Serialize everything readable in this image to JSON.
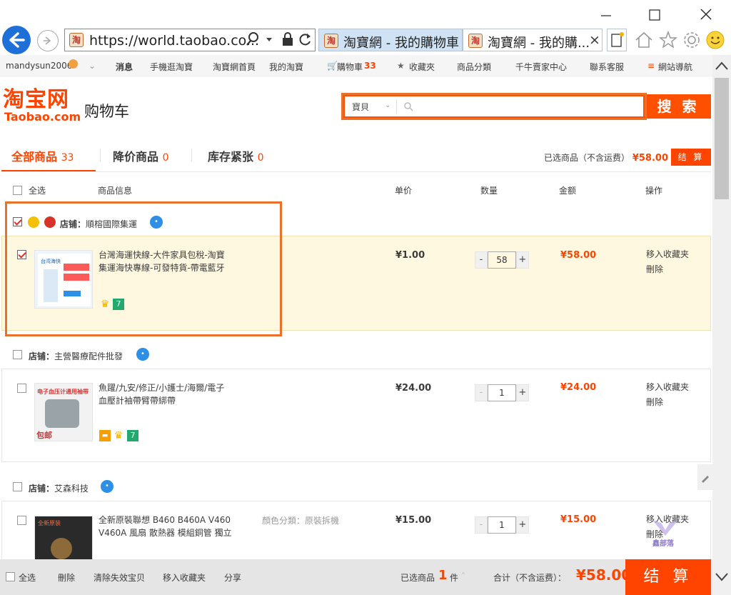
{
  "browser": {
    "url": "https://world.taobao.co...",
    "tabs": [
      {
        "title": "淘寶網 - 我的購物車"
      },
      {
        "title": "淘寶網 - 我的購..."
      }
    ],
    "tab_close": "×"
  },
  "sitenav": {
    "user": "mandysun2006",
    "messages": "消息",
    "mobile": "手機逛淘寶",
    "home": "淘寶網首頁",
    "my_taobao": "我的淘寶",
    "cart_label": "購物車",
    "cart_count": "33",
    "favorites": "收藏夾",
    "categories": "商品分類",
    "seller_center": "千牛賣家中心",
    "support": "聯系客服",
    "sitemap": "網站導航"
  },
  "header": {
    "logo_cn": "淘宝网",
    "logo_en": "Taobao.com",
    "page_title": "购物车",
    "search_category": "寶貝",
    "search_placeholder": "",
    "search_button": "搜 索"
  },
  "tabs": [
    {
      "label": "全部商品",
      "count": "33"
    },
    {
      "label": "降价商品",
      "count": "0"
    },
    {
      "label": "库存紧张",
      "count": "0"
    }
  ],
  "summary": {
    "label": "已选商品（不含运费）",
    "amount": "¥58.00",
    "settle": "结 算"
  },
  "columns": {
    "select_all": "全选",
    "info": "商品信息",
    "unit_price": "单价",
    "quantity": "数量",
    "amount": "金额",
    "ops": "操作"
  },
  "shops": [
    {
      "shop_label": "店铺：",
      "shop_name": "順榕國際集運",
      "item": {
        "title_line1": "台灣海運快線-大件家具包稅-淘寶",
        "title_line2": "集運海快專線-可發特貨-帶電藍牙",
        "price": "¥1.00",
        "qty": "58",
        "total": "¥58.00",
        "op_fav": "移入收藏夹",
        "op_del": "刪除",
        "thumb_text": "台湾海快",
        "selected": true
      }
    },
    {
      "shop_label": "店铺：",
      "shop_name": "主營醫療配件批發",
      "item": {
        "title_line1": "魚躍/九安/修正/小護士/海爾/電子",
        "title_line2": "血壓計袖帶臂帶綁帶",
        "price": "¥24.00",
        "qty": "1",
        "total": "¥24.00",
        "op_fav": "移入收藏夹",
        "op_del": "刪除",
        "thumb_text": "电子血压计通用袖带",
        "thumb_sub": "包邮",
        "selected": false
      }
    },
    {
      "shop_label": "店铺：",
      "shop_name": "艾森科技",
      "item": {
        "title_line1": "全新原裝聯想 B460 B460A V460",
        "title_line2": "V460A 風扇 散熱器 模組銅管 獨立",
        "sku": "顏色分類：原裝拆機",
        "price": "¥15.00",
        "qty": "1",
        "total": "¥15.00",
        "op_fav": "移入收藏夹",
        "op_del": "刪除",
        "thumb_text": "全新原装",
        "selected": false
      }
    }
  ],
  "bottom": {
    "select_all": "全选",
    "delete": "刪除",
    "clear_invalid": "清除失效宝贝",
    "move_fav": "移入收藏夹",
    "share": "分享",
    "selected_label": "已选商品",
    "selected_count": "1",
    "unit": "件",
    "total_label": "合计（不含运费）：",
    "total_amount": "¥58.00",
    "settle": "结 算"
  },
  "watermark": "鑫部落",
  "colors": {
    "accent": "#ff4400",
    "highlight": "#fff8e1",
    "annotation": "#e8722c"
  }
}
